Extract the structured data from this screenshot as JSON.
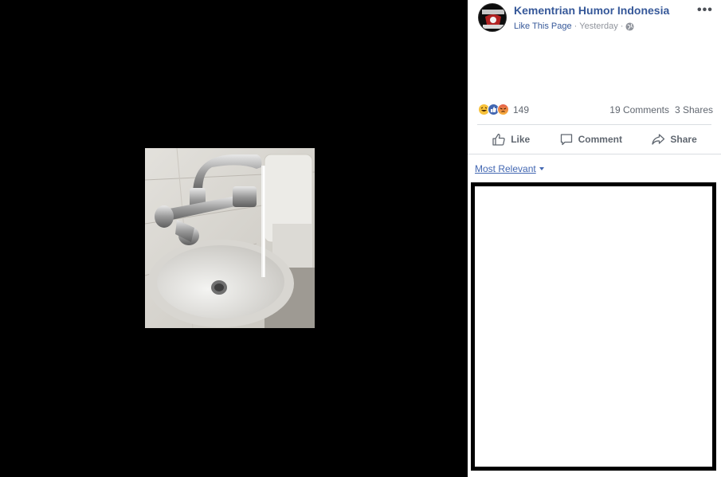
{
  "post": {
    "page_name": "Kementrian Humor Indonesia",
    "like_page": "Like This Page",
    "separator": "·",
    "time": "Yesterday",
    "more": "•••"
  },
  "reactions": {
    "types": [
      "haha",
      "like",
      "angry"
    ],
    "count": "149"
  },
  "stats": {
    "comments": "19 Comments",
    "shares": "3 Shares"
  },
  "actions": {
    "like": "Like",
    "comment": "Comment",
    "share": "Share"
  },
  "comments": {
    "sort_label": "Most Relevant"
  },
  "colors": {
    "link": "#365899",
    "meta": "#90949c",
    "action": "#606770",
    "divider": "#dadde1"
  }
}
